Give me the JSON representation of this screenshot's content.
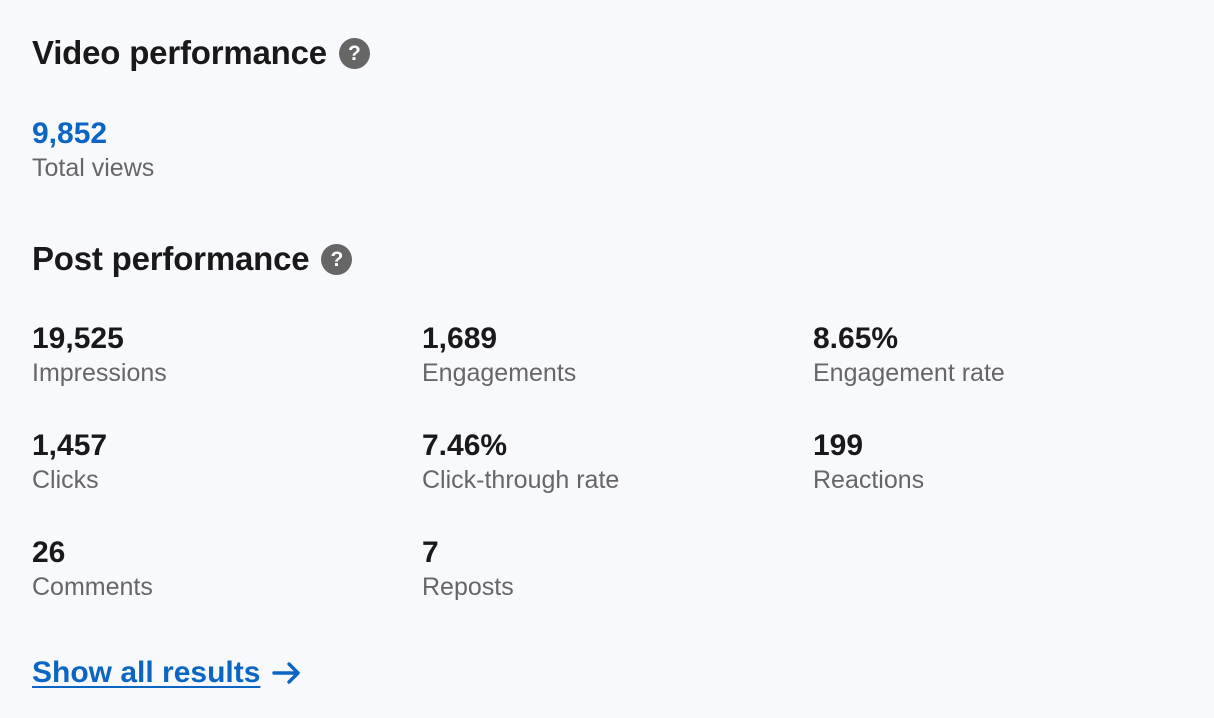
{
  "video_performance": {
    "title": "Video performance",
    "help_icon": "question-circle-icon",
    "total_views_value": "9,852",
    "total_views_label": "Total views"
  },
  "post_performance": {
    "title": "Post performance",
    "help_icon": "question-circle-icon",
    "metrics": [
      {
        "value": "19,525",
        "label": "Impressions"
      },
      {
        "value": "1,689",
        "label": "Engagements"
      },
      {
        "value": "8.65%",
        "label": "Engagement rate"
      },
      {
        "value": "1,457",
        "label": "Clicks"
      },
      {
        "value": "7.46%",
        "label": "Click-through rate"
      },
      {
        "value": "199",
        "label": "Reactions"
      },
      {
        "value": "26",
        "label": "Comments"
      },
      {
        "value": "7",
        "label": "Reposts"
      }
    ]
  },
  "show_all": {
    "label": "Show all results",
    "icon": "arrow-right-icon"
  },
  "colors": {
    "link": "#0a66c2",
    "text_primary": "#191919",
    "text_secondary": "#666666",
    "background": "#f8f9fc"
  }
}
